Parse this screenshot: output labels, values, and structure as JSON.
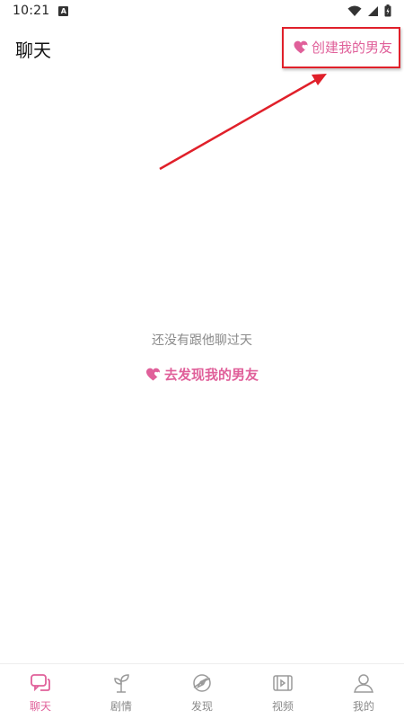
{
  "status_bar": {
    "time": "10:21",
    "notification_icon": "a-icon"
  },
  "header": {
    "title": "聊天",
    "create_label": "创建我的男友"
  },
  "empty_state": {
    "message": "还没有跟他聊过天",
    "discover_label": "去发现我的男友"
  },
  "bottom_nav": {
    "items": [
      {
        "label": "聊天",
        "icon": "chat-icon",
        "active": true
      },
      {
        "label": "剧情",
        "icon": "sprout-icon",
        "active": false
      },
      {
        "label": "发现",
        "icon": "compass-icon",
        "active": false
      },
      {
        "label": "视频",
        "icon": "video-icon",
        "active": false
      },
      {
        "label": "我的",
        "icon": "profile-icon",
        "active": false
      }
    ]
  },
  "colors": {
    "accent": "#e0609a",
    "annotation": "#e0202a",
    "inactive": "#8a8a8a"
  }
}
